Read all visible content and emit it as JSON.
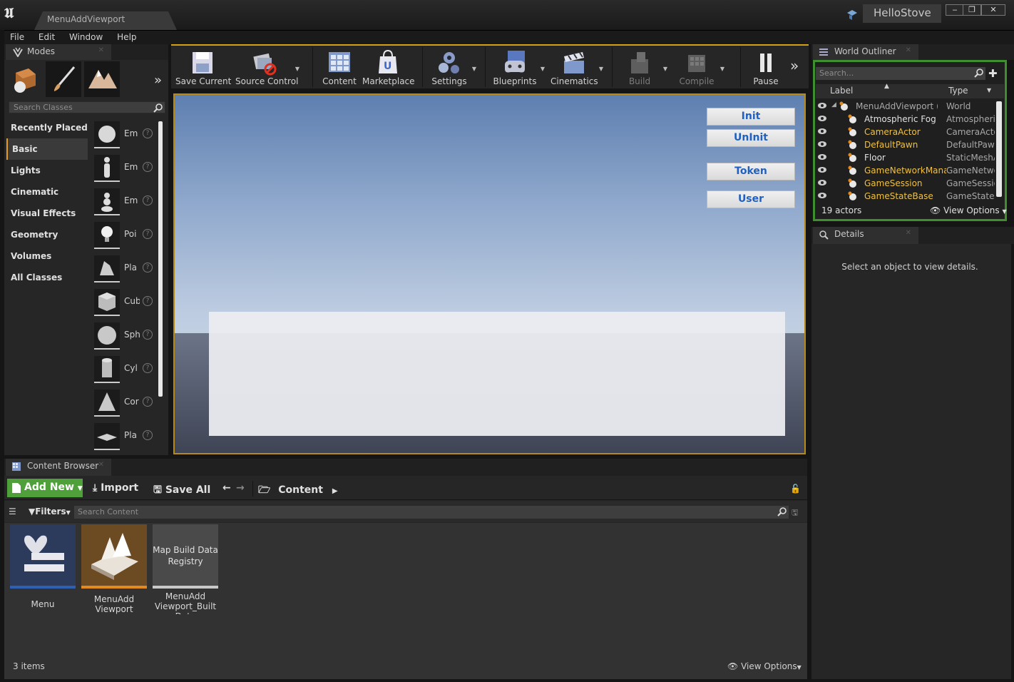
{
  "window": {
    "document_tab": "MenuAddViewport",
    "project": "HelloStove",
    "controls": [
      "‒",
      "❐",
      "✕"
    ]
  },
  "menu": [
    "File",
    "Edit",
    "Window",
    "Help"
  ],
  "modes": {
    "tab_label": "Modes",
    "search_placeholder": "Search Classes",
    "categories": [
      "Recently Placed",
      "Basic",
      "Lights",
      "Cinematic",
      "Visual Effects",
      "Geometry",
      "Volumes",
      "All Classes"
    ],
    "active_category": "Basic",
    "items": [
      "Em",
      "Em",
      "Em",
      "Poi",
      "Pla",
      "Cub",
      "Sph",
      "Cyl",
      "Cor",
      "Pla"
    ]
  },
  "toolbar": {
    "buttons": [
      {
        "label": "Save Current",
        "icon": "save-icon"
      },
      {
        "label": "Source Control",
        "icon": "source-control-icon"
      },
      {
        "label": "Content",
        "icon": "content-icon"
      },
      {
        "label": "Marketplace",
        "icon": "marketplace-icon"
      },
      {
        "label": "Settings",
        "icon": "settings-icon"
      },
      {
        "label": "Blueprints",
        "icon": "blueprints-icon"
      },
      {
        "label": "Cinematics",
        "icon": "cinematics-icon"
      },
      {
        "label": "Build",
        "icon": "build-icon"
      },
      {
        "label": "Compile",
        "icon": "compile-icon"
      },
      {
        "label": "Pause",
        "icon": "pause-icon"
      }
    ]
  },
  "viewport": {
    "buttons": [
      "Init",
      "UnInit",
      "Token",
      "User"
    ]
  },
  "outliner": {
    "tab_label": "World Outliner",
    "search_placeholder": "Search...",
    "col_label": "Label",
    "col_type": "Type",
    "rows": [
      {
        "label": "MenuAddViewport (Pla",
        "type": "World",
        "color": "#a8a8a8"
      },
      {
        "label": "Atmospheric Fog",
        "type": "Atmospheric",
        "color": "#e0e0e0"
      },
      {
        "label": "CameraActor",
        "type": "CameraActo",
        "color": "#f0c040"
      },
      {
        "label": "DefaultPawn",
        "type": "DefaultPawn",
        "color": "#f0c040"
      },
      {
        "label": "Floor",
        "type": "StaticMeshA",
        "color": "#e0e0e0"
      },
      {
        "label": "GameNetworkManag",
        "type": "GameNetwo",
        "color": "#f0c040"
      },
      {
        "label": "GameSession",
        "type": "GameSessio",
        "color": "#f0c040"
      },
      {
        "label": "GameStateBase",
        "type": "GameStateB",
        "color": "#f0c040"
      }
    ],
    "actor_count": "19 actors",
    "view_options": "View Options"
  },
  "details": {
    "tab_label": "Details",
    "message": "Select an object to view details."
  },
  "content_browser": {
    "tab_label": "Content Browser",
    "add_new": "Add New",
    "import": "Import",
    "save_all": "Save All",
    "path": "Content",
    "filters": "Filters",
    "search_placeholder": "Search Content",
    "assets": [
      {
        "name": "Menu",
        "bar_color": "#2f5fb0"
      },
      {
        "name": "MenuAdd Viewport",
        "bar_color": "#e08a20"
      },
      {
        "name": "MenuAdd Viewport_Built Data",
        "thumb_text": "Map Build Data Registry",
        "bar_color": "#c8c8c8"
      }
    ],
    "items_count": "3 items",
    "view_options": "View Options"
  },
  "colors": {
    "accent_orange": "#d3a017",
    "outliner_green": "#3f8f2f",
    "add_new_green": "#4f9f3a",
    "button_blue_text": "#2060c0"
  }
}
